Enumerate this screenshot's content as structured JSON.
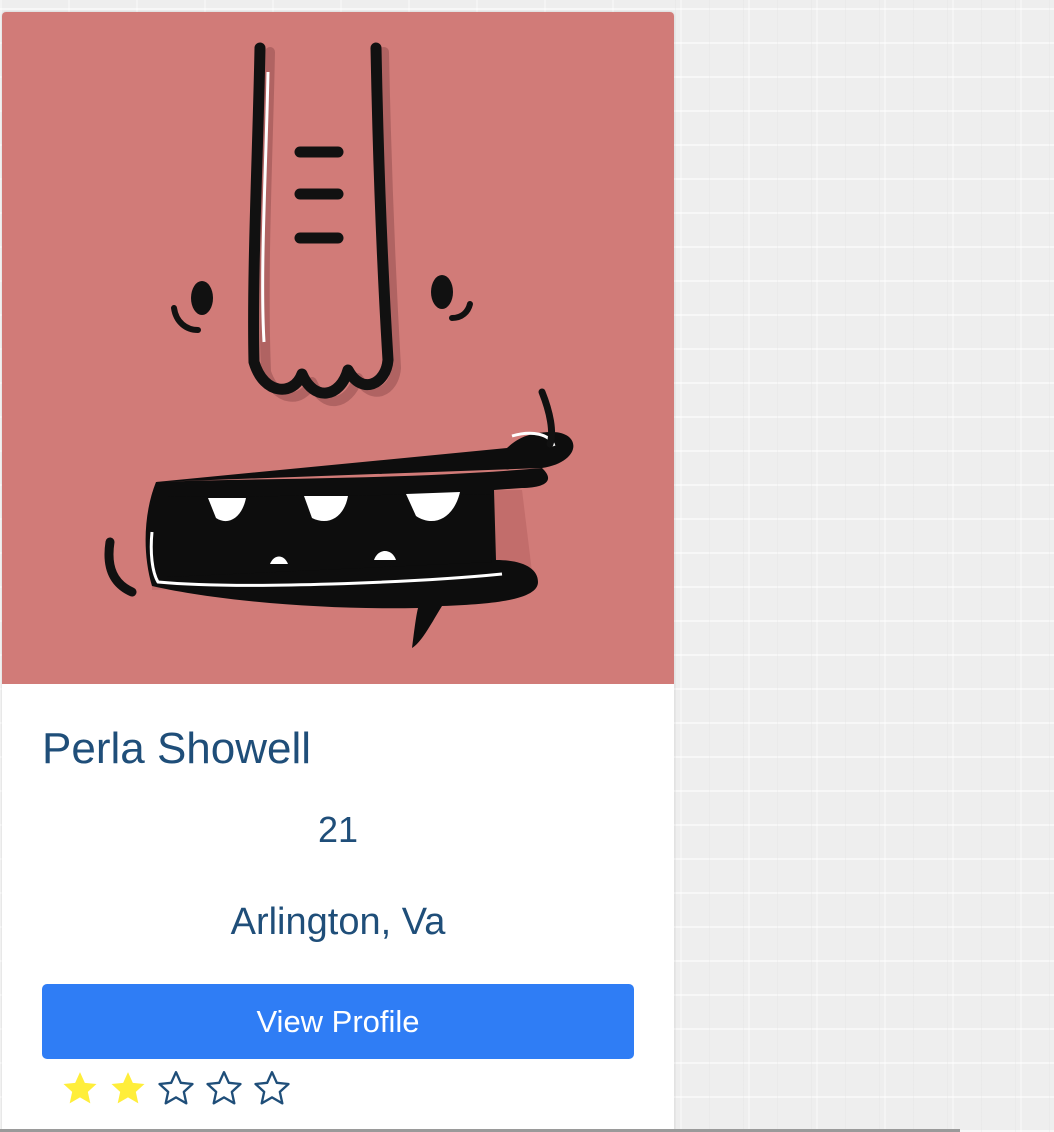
{
  "profile": {
    "name": "Perla Showell",
    "age": "21",
    "location": "Arlington, Va",
    "view_button_label": "View Profile",
    "avatar_icon": "monster-face-avatar",
    "avatar_bg_color": "#d17b78"
  },
  "rating": {
    "value": 2,
    "max": 5,
    "filled_color": "#ffee3a",
    "empty_color": "#1f4e79"
  },
  "colors": {
    "text": "#1f4e79",
    "button": "#2f7df5",
    "page_bg": "#eeeeee"
  }
}
